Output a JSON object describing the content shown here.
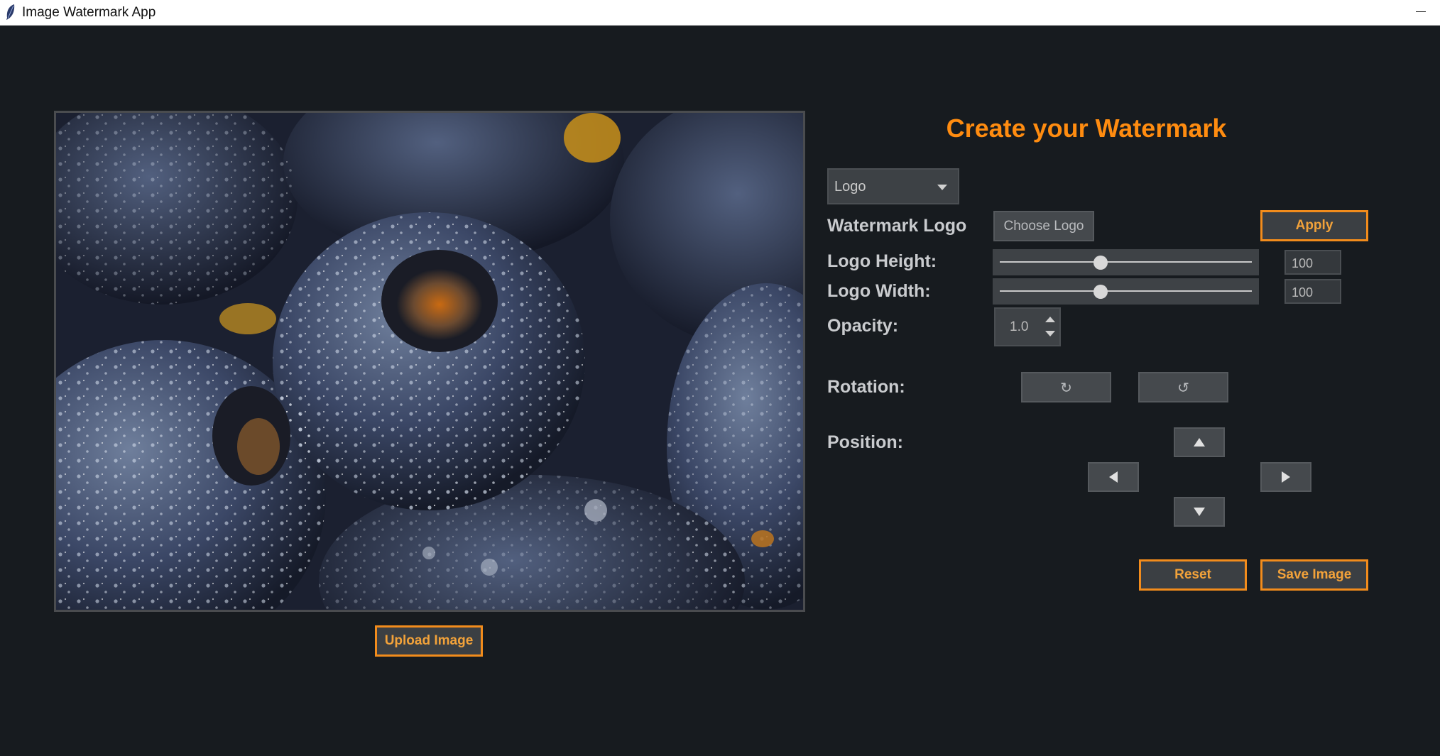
{
  "window": {
    "title": "Image Watermark App",
    "minimize_icon": "minimize-icon",
    "app_icon": "feather-icon"
  },
  "image_preview": {
    "subject": "blueberries-photo"
  },
  "buttons": {
    "upload": "Upload Image",
    "choose_logo": "Choose Logo",
    "apply": "Apply",
    "reset": "Reset",
    "save": "Save Image"
  },
  "panel": {
    "heading": "Create your Watermark",
    "dropdown_value": "Logo",
    "watermark_logo_label": "Watermark Logo",
    "logo_height_label": "Logo Height:",
    "logo_width_label": "Logo Width:",
    "opacity_label": "Opacity:",
    "rotation_label": "Rotation:",
    "position_label": "Position:",
    "logo_height_value": "100",
    "logo_width_value": "100",
    "logo_height_slider": 0.4,
    "logo_width_slider": 0.4,
    "opacity_value": "1.0",
    "rotate_cw_glyph": "↻",
    "rotate_ccw_glyph": "↺"
  },
  "colors": {
    "accent": "#ff8c10",
    "background": "#171b1f",
    "control": "#45494d"
  }
}
